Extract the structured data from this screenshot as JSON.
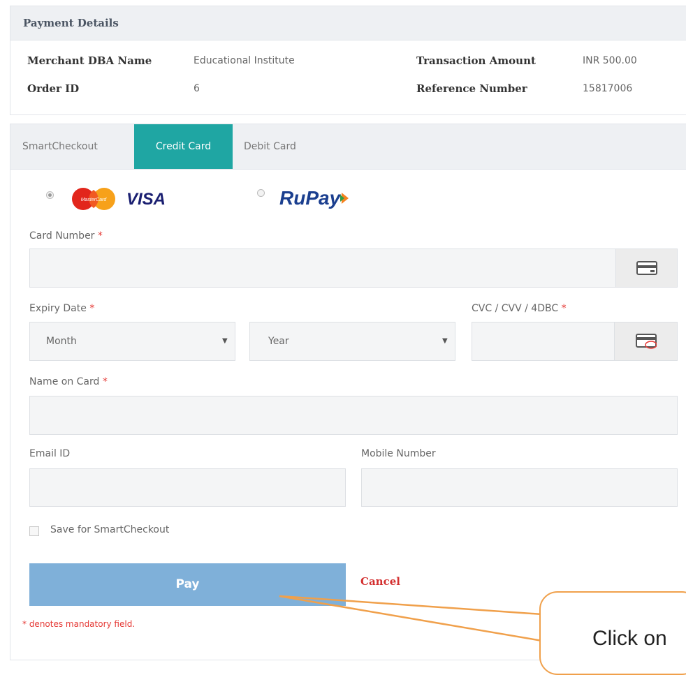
{
  "payment_details": {
    "title": "Payment Details",
    "merchant_label": "Merchant DBA Name",
    "merchant_value": "Educational Institute",
    "order_label": "Order ID",
    "order_value": "6",
    "amount_label": "Transaction Amount",
    "amount_value": "INR 500.00",
    "reference_label": "Reference Number",
    "reference_value": "15817006"
  },
  "tabs": [
    {
      "label": "SmartCheckout"
    },
    {
      "label": "Credit Card"
    },
    {
      "label": "Debit Card"
    }
  ],
  "active_tab": "Credit Card",
  "card_types": {
    "mastercard_visa_selected": true,
    "rupay_selected": false,
    "mastercard_text": "MasterCard",
    "visa_text": "VISA",
    "rupay_text": "RuPay"
  },
  "form": {
    "required_mark": "*",
    "card_number_label": "Card Number",
    "expiry_label": "Expiry Date",
    "month_placeholder": "Month",
    "year_placeholder": "Year",
    "cvv_label": "CVC / CVV / 4DBC",
    "name_label": "Name on Card",
    "email_label": "Email ID",
    "mobile_label": "Mobile Number",
    "save_label": "Save for SmartCheckout",
    "pay_label": "Pay",
    "cancel_label": "Cancel",
    "mandatory_note": "* denotes mandatory field."
  },
  "callout": {
    "text": "Click on"
  },
  "colors": {
    "accent_teal": "#1fa6a3",
    "pay_button": "#7fb0d9",
    "required_red": "#e53935",
    "callout_orange": "#f0a04b"
  }
}
